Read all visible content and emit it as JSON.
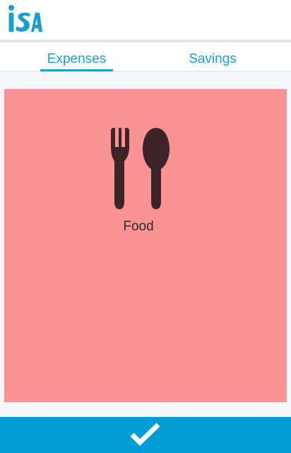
{
  "app": {
    "logo_text": "iSA",
    "logo_icon": "isa-logo"
  },
  "tabs": [
    {
      "label": "Expenses",
      "selected": true
    },
    {
      "label": "Savings",
      "selected": false
    }
  ],
  "category": {
    "label": "Food",
    "icon": "fork-spoon-icon"
  },
  "confirm_button": {
    "icon": "checkmark-icon"
  },
  "colors": {
    "accent": "#1a9fcd",
    "card_background": "#f99393",
    "icon": "#3d2428",
    "button_background": "#009dd7",
    "content_background": "#f6f7fb"
  }
}
